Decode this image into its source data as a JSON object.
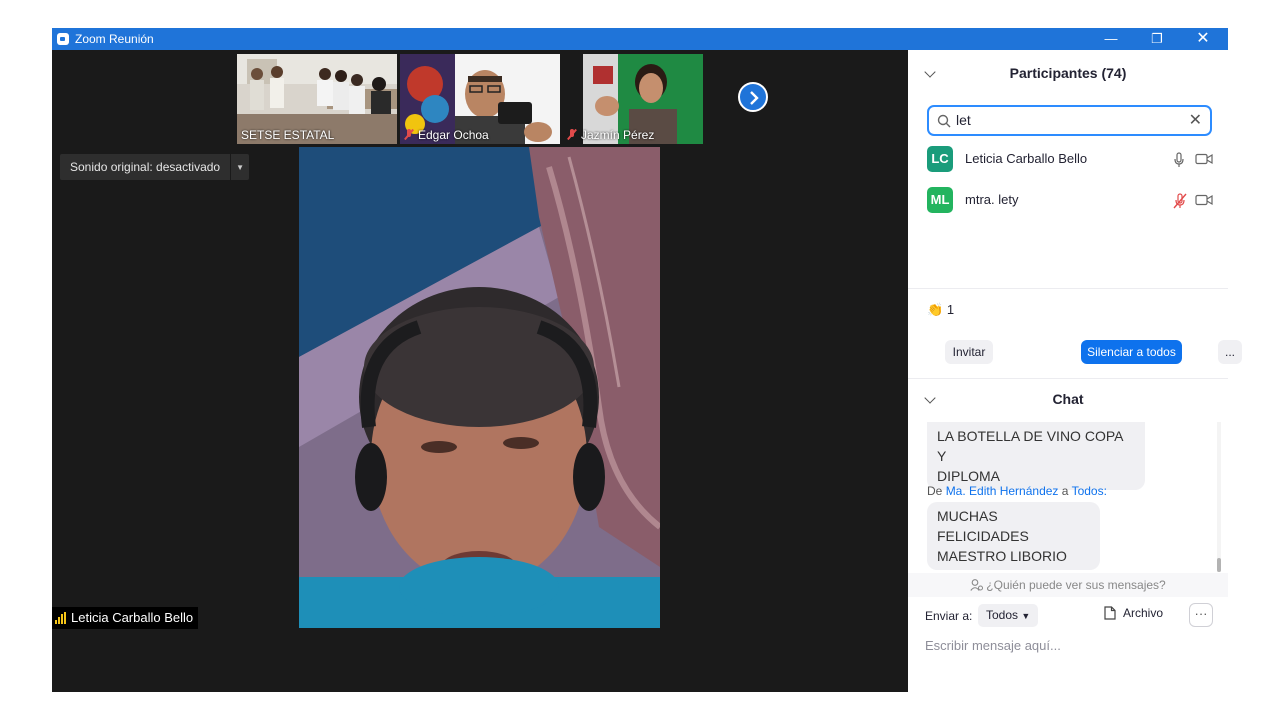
{
  "window": {
    "title": "Zoom Reunión",
    "minimize": "—",
    "restore": "❐",
    "close": "✕"
  },
  "thumbnails": [
    {
      "name": "SETSE ESTATAL",
      "muted": false
    },
    {
      "name": "Edgar Ochoa",
      "muted": true
    },
    {
      "name": "Jazmín Pérez",
      "muted": true
    }
  ],
  "sound_dropdown": {
    "label": "Sonido original: desactivado"
  },
  "active_speaker": {
    "name": "Leticia Carballo Bello"
  },
  "participants": {
    "header": "Participantes (74)",
    "search_value": "let",
    "list": [
      {
        "initials": "LC",
        "name": "Leticia Carballo Bello",
        "color": "#1a9c7b",
        "mic_muted": false
      },
      {
        "initials": "ML",
        "name": "mtra. lety",
        "color": "#23b45f",
        "mic_muted": true
      }
    ],
    "reaction": {
      "icon": "clap-icon",
      "emoji": "👏",
      "count": "1"
    },
    "invite_label": "Invitar",
    "mute_all_label": "Silenciar a todos",
    "more_label": "..."
  },
  "chat": {
    "header": "Chat",
    "messages": [
      {
        "text_line1": "LA BOTELLA DE VINO COPA Y",
        "text_line2": "DIPLOMA"
      },
      {
        "from_prefix": "De",
        "sender": "Ma. Edith Hernández",
        "to_word": "a",
        "recipient": "Todos",
        "text_line1": "MUCHAS FELICIDADES",
        "text_line2": "MAESTRO LIBORIO"
      }
    ],
    "who_can_see": "¿Quién puede ver sus mensajes?",
    "send_to_label": "Enviar a:",
    "send_to_value": "Todos",
    "file_label": "Archivo",
    "more_label": "···",
    "compose_placeholder": "Escribir mensaje aquí..."
  },
  "colors": {
    "accent": "#0e72ed",
    "titlebar": "#1f74d9",
    "video_bg": "#1a1a1a",
    "muted_red": "#e24b4b"
  }
}
